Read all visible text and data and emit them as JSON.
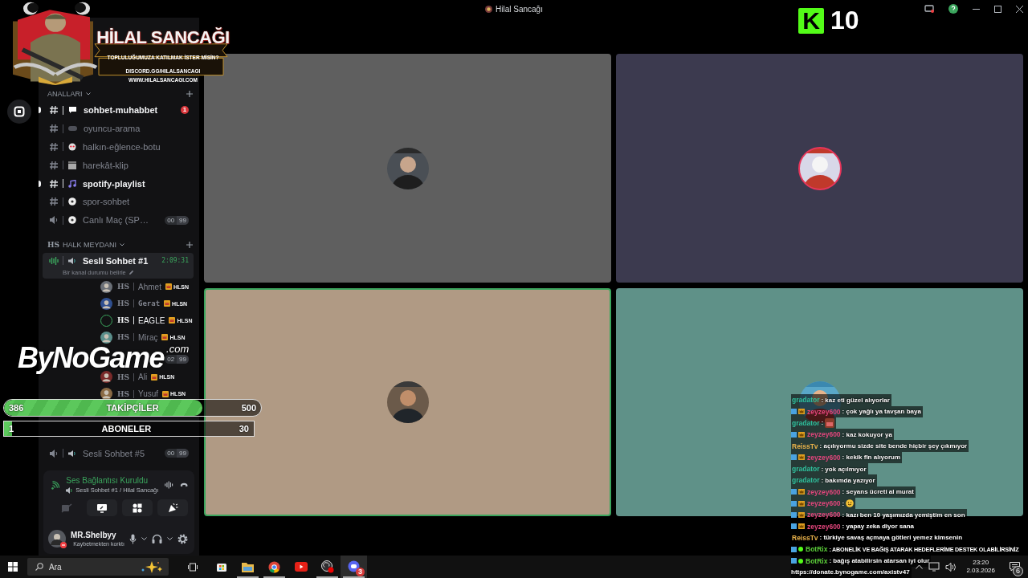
{
  "window": {
    "title": "Hilal Sancağı"
  },
  "banner": {
    "title": "HİLAL SANCAĞI",
    "lines": [
      "TOPLULUĞUMUZA KATILMAK İSTER MİSİN?",
      "DISCORD.GG/HILALSANCAGI",
      "WWW.HILALSANCAGI.COM"
    ]
  },
  "kick_counter": {
    "logo": "K",
    "count": "10"
  },
  "sidebar": {
    "sections": [
      {
        "name": "ANALLARI",
        "channels": [
          {
            "kind": "text",
            "name": "sohbet-muhabbet",
            "unread": true,
            "mentions": "1"
          },
          {
            "kind": "text",
            "name": "oyuncu-arama",
            "unread": false
          },
          {
            "kind": "text",
            "name": "halkın-eğlence-botu",
            "unread": false
          },
          {
            "kind": "text",
            "name": "harekât-klip",
            "unread": false
          },
          {
            "kind": "text",
            "name": "spotify-playlist",
            "unread": true
          },
          {
            "kind": "text",
            "name": "spor-sohbet",
            "unread": false
          },
          {
            "kind": "voice",
            "name": "Canlı Maç (SP…",
            "counts": [
              "00",
              "99"
            ],
            "selected": false
          }
        ]
      },
      {
        "tag": "HS",
        "name": "HALK MEYDANI",
        "channels": [
          {
            "kind": "voice",
            "name": "Sesli Sohbet #1",
            "selected": true,
            "timer": "2:09:31",
            "status": "Bir kanal durumu belirle",
            "members": [
              {
                "tag": "HS",
                "name": "Ahmet",
                "role": "HLSN",
                "speaking": false
              },
              {
                "tag": "HS",
                "name": "Gerat",
                "role": "HLSN",
                "speaking": false
              },
              {
                "tag": "HS",
                "name": "EAGLE",
                "role": "HLSN",
                "speaking": true
              },
              {
                "tag": "HS",
                "name": "Miraç",
                "role": "HLSN",
                "speaking": false
              }
            ]
          },
          {
            "kind": "voice",
            "counts": [
              "02",
              "99"
            ],
            "selected": false,
            "members": [
              {
                "tag": "HS",
                "name": "Ali",
                "role": "HLSN",
                "speaking": false
              },
              {
                "tag": "HS",
                "name": "Yusuf",
                "role": "HLSN",
                "speaking": false
              }
            ]
          },
          {
            "kind": "voice",
            "name": "Sesli Sohbet #5",
            "counts": [
              "00",
              "99"
            ],
            "selected": false
          }
        ]
      }
    ]
  },
  "voice_panel": {
    "status": "Ses Bağlantısı Kuruldu",
    "channel": "Sesli Sohbet #1 / Hilal Sancağı"
  },
  "user_panel": {
    "name": "MR.Shelbyy",
    "status": "Kaybetmekten korktı"
  },
  "tiles": [
    {
      "color": "#5f5f5f",
      "speaking": false
    },
    {
      "color": "#3c3a4f",
      "speaking": false
    },
    {
      "color": "#b09a84",
      "speaking": true
    },
    {
      "color": "#5f9188",
      "speaking": false
    }
  ],
  "bynogame": {
    "name": "ByNoGame",
    "domain": ".com"
  },
  "stream_goals": {
    "followers": {
      "current": "386",
      "label": "TAKİPÇİLER",
      "goal": "500",
      "level": 0.772
    },
    "subscribers": {
      "current": "1",
      "label": "ABONELER",
      "goal": "30",
      "level": 0.033
    }
  },
  "chat": [
    {
      "kind": "text",
      "subscriber": false,
      "bot": false,
      "user": "gradator",
      "color": "#2fbf9c",
      "text": ": kaz eti güzel alıyorlar"
    },
    {
      "kind": "text",
      "subscriber": true,
      "bot": false,
      "user": "zeyzey600",
      "color": "#e0457b",
      "text": ": çok yağlı ya tavşan baya"
    },
    {
      "kind": "sticker",
      "subscriber": false,
      "bot": false,
      "user": "gradator",
      "color": "#2fbf9c",
      "text": ":"
    },
    {
      "kind": "text",
      "subscriber": true,
      "bot": false,
      "user": "zeyzey600",
      "color": "#e0457b",
      "text": ": kaz kokuyor ya"
    },
    {
      "kind": "text",
      "subscriber": false,
      "bot": false,
      "user": "ReissTv",
      "color": "#e6b04a",
      "text": ": açılıyormu sizde site bende hiçbir şey çıkmıyor"
    },
    {
      "kind": "text",
      "subscriber": true,
      "bot": false,
      "user": "zeyzey600",
      "color": "#e0457b",
      "text": ": kekik fln alıyorum"
    },
    {
      "kind": "text",
      "subscriber": false,
      "bot": false,
      "user": "gradator",
      "color": "#2fbf9c",
      "text": ": yok açılmıyor"
    },
    {
      "kind": "text",
      "subscriber": false,
      "bot": false,
      "user": "gradator",
      "color": "#2fbf9c",
      "text": ": bakımda yazıyor"
    },
    {
      "kind": "text",
      "subscriber": true,
      "bot": false,
      "user": "zeyzey600",
      "color": "#e0457b",
      "text": ": seyans ücreti al murat"
    },
    {
      "kind": "smiley",
      "subscriber": true,
      "bot": false,
      "user": "zeyzey600",
      "color": "#e0457b",
      "text": ":"
    },
    {
      "kind": "text",
      "subscriber": true,
      "bot": false,
      "user": "zeyzey600",
      "color": "#e0457b",
      "text": ": kazı ben 10 yaşımızda yemiştim en son"
    },
    {
      "kind": "text",
      "subscriber": true,
      "bot": false,
      "user": "zeyzey600",
      "color": "#e0457b",
      "text": ": yapay zeka diyor sana"
    },
    {
      "kind": "text",
      "subscriber": false,
      "bot": false,
      "user": "ReissTv",
      "color": "#e6b04a",
      "text": ": türkiye savaş açmaya götleri yemez kimsenin"
    },
    {
      "kind": "text",
      "subscriber": false,
      "bot": true,
      "user": "BotRix",
      "color": "#5ccf3a",
      "text": ": ABONELİK VE BAĞIŞ ATARAK HEDEFLERİME DESTEK OLABİLİRSİNİZ"
    },
    {
      "kind": "text",
      "subscriber": false,
      "bot": true,
      "user": "BotRix",
      "color": "#5ccf3a",
      "text": ": bağış atabilirsin atarsan iyi olur"
    },
    {
      "kind": "link",
      "text": "https://donate.bynogame.com/axistv47"
    }
  ],
  "taskbar": {
    "search": {
      "placeholder": "Ara"
    },
    "apps": [
      {
        "selected": false,
        "running": false
      },
      {
        "selected": false,
        "running": true
      },
      {
        "selected": false,
        "running": true
      },
      {
        "selected": false,
        "running": false
      },
      {
        "selected": false,
        "running": true
      },
      {
        "selected": true,
        "running": true,
        "badge": "3"
      }
    ],
    "time": "23:20",
    "date": "2.03.2026",
    "notifications": "6"
  }
}
